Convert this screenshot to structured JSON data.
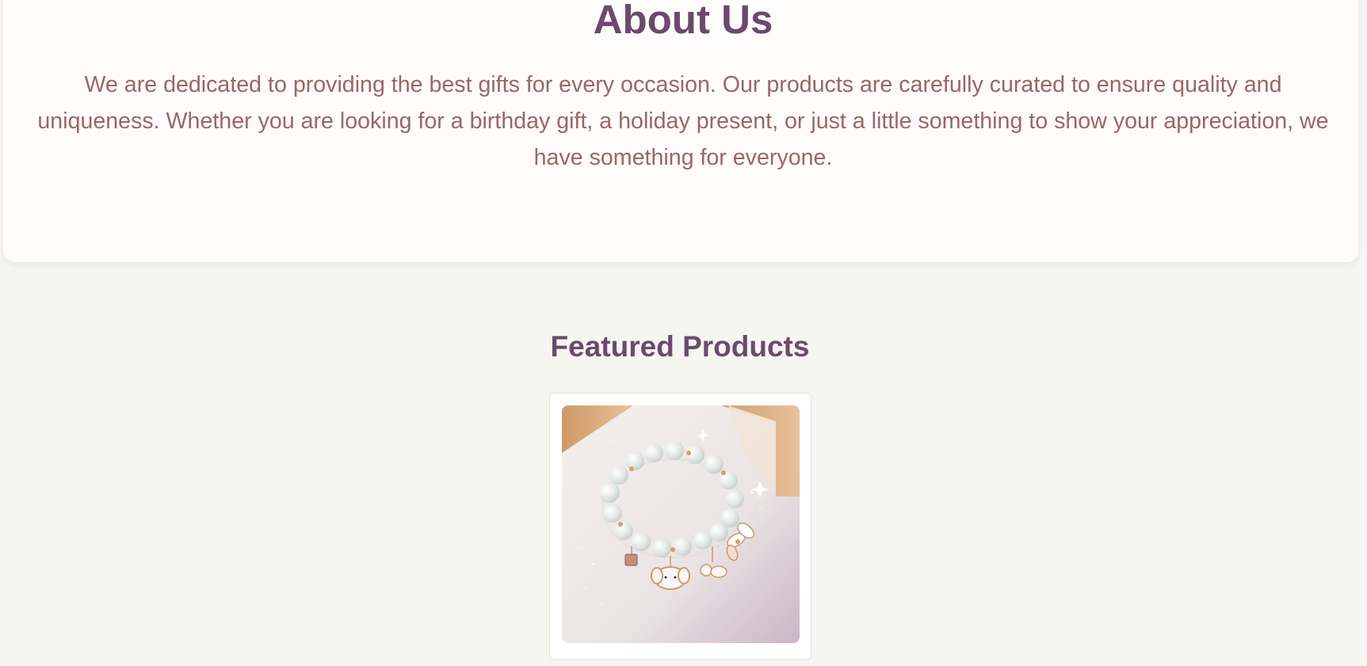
{
  "about": {
    "title": "About Us",
    "text": "We are dedicated to providing the best gifts for every occasion. Our products are carefully curated to ensure quality and uniqueness. Whether you are looking for a birthday gift, a holiday present, or just a little something to show your appreciation, we have something for everyone."
  },
  "featured": {
    "title": "Featured Products",
    "products": [
      {
        "image_icon": "bracelet-product-photo"
      }
    ]
  },
  "colors": {
    "heading": "#6b4a6c",
    "body_text": "#9a6668",
    "page_bg": "#f5f5f2",
    "card_bg": "#fdfcfb"
  }
}
